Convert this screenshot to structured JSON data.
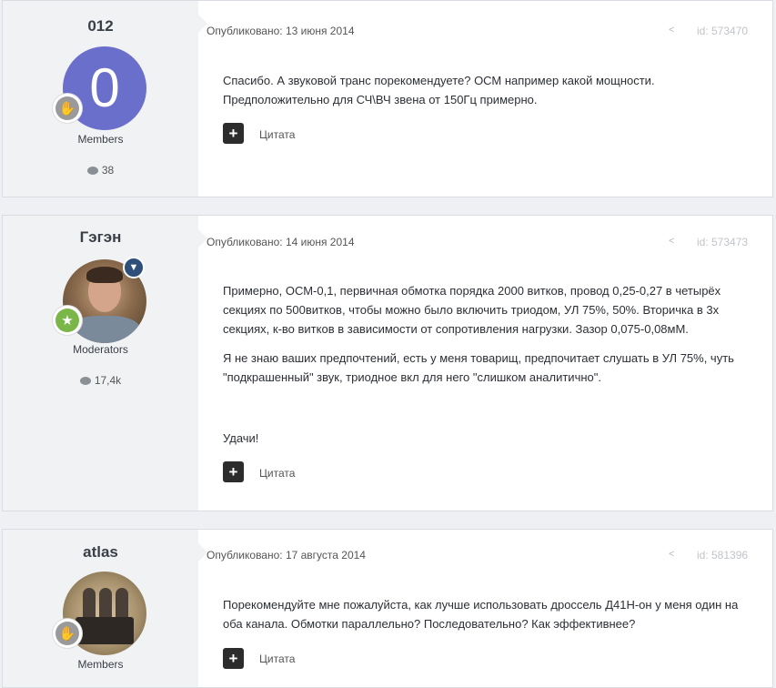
{
  "posts": [
    {
      "author": "012",
      "avatar_letter": "0",
      "group": "Members",
      "post_count": "38",
      "published": "Опубликовано: 13 июня 2014",
      "id": "id: 573470",
      "paragraphs": [
        "Спасибо. А звуковой транс порекомендуете? ОСМ например какой мощности. Предположительно для СЧ\\ВЧ звена от 150Гц примерно."
      ],
      "quote": "Цитата"
    },
    {
      "author": "Гэгэн",
      "group": "Moderators",
      "post_count": "17,4k",
      "published": "Опубликовано: 14 июня 2014",
      "id": "id: 573473",
      "paragraphs": [
        "Примерно, ОСМ-0,1, первичная обмотка порядка 2000 витков, провод 0,25-0,27 в четырёх секциях по 500витков, чтобы можно было включить триодом, УЛ 75%, 50%. Вторичка в 3х секциях, к-во витков в зависимости от сопротивления нагрузки. Зазор 0,075-0,08мМ.",
        "Я не знаю ваших предпочтений, есть у меня товарищ, предпочитает слушать в УЛ 75%, чуть \"подкрашенный\" звук, триодное вкл для него \"слишком аналитично\".",
        "Удачи!"
      ],
      "quote": "Цитата"
    },
    {
      "author": "atlas",
      "group": "Members",
      "published": "Опубликовано: 17 августа 2014",
      "id": "id: 581396",
      "paragraphs": [
        "Порекомендуйте мне пожалуйста, как лучше использовать дроссель Д41Н-он у меня один на оба канала. Обмотки параллельно? Последовательно? Как эффективнее?"
      ],
      "quote": "Цитата"
    }
  ],
  "icons": {
    "share": "share-icon",
    "comment": "comment-icon",
    "quote": "plus-icon",
    "rank": "hand-wave-icon",
    "star": "star-icon",
    "moderator": "shield-icon"
  },
  "colors": {
    "avatar_letter_bg": "#6b6fcc",
    "author_panel_bg": "#f1f2f4",
    "quote_button_bg": "#2c2c2c",
    "moderator_badge": "#2d4f7a",
    "star_badge": "#7ab648"
  }
}
